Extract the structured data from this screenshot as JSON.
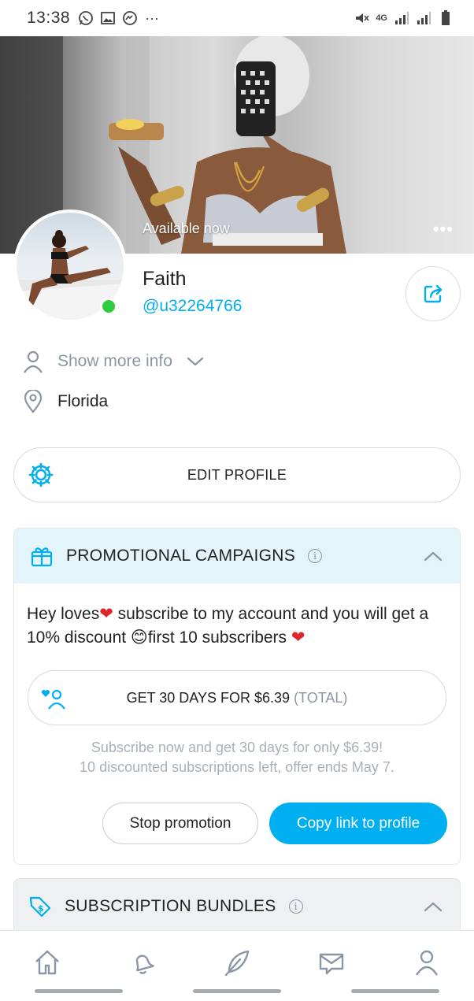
{
  "status_bar": {
    "time": "13:38",
    "left_icons": [
      "whatsapp-icon",
      "gallery-icon",
      "messenger-icon",
      "more-dots-icon"
    ],
    "right_icons": [
      "mute-icon",
      "4g-icon",
      "signal-icon",
      "signal-icon-2",
      "battery-icon"
    ],
    "network_label": "4G"
  },
  "cover": {
    "available_label": "Available now",
    "more_label": "•••"
  },
  "profile": {
    "name": "Faith",
    "handle": "@u32264766",
    "online": true
  },
  "info": {
    "show_more_label": "Show more info",
    "location": "Florida"
  },
  "edit_profile_label": "EDIT PROFILE",
  "promo": {
    "title": "PROMOTIONAL CAMPAIGNS",
    "text_part1": "Hey loves",
    "text_part2": " subscribe to my account and you will get a 10% discount ",
    "text_part3": "first 10 subscribers ",
    "get_label": "GET 30 DAYS FOR $6.39",
    "get_total": "(TOTAL)",
    "note_line1": "Subscribe now and get 30 days for only $6.39!",
    "note_line2": "10 discounted subscriptions left, offer ends May 7.",
    "stop_label": "Stop promotion",
    "copy_label": "Copy link to profile"
  },
  "bundles": {
    "title": "SUBSCRIPTION BUNDLES"
  },
  "nav": [
    "home-icon",
    "bell-icon",
    "feather-icon",
    "messages-icon",
    "profile-icon"
  ],
  "colors": {
    "accent": "#00aff0",
    "online": "#2ecc40",
    "heart": "#e0242b",
    "promo_header_bg": "#e4f4fb"
  }
}
